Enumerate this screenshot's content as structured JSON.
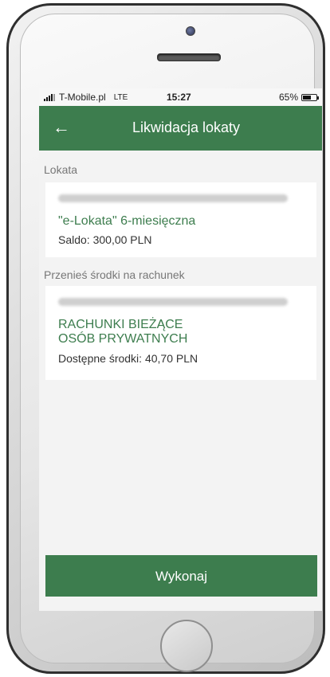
{
  "status_bar": {
    "carrier": "T-Mobile.pl",
    "network": "LTE",
    "time": "15:27",
    "battery": "65%",
    "battery_level": 0.65
  },
  "app_bar": {
    "back_icon": "arrow-left-icon",
    "title": "Likwidacja lokaty"
  },
  "deposit_section": {
    "label": "Lokata",
    "card": {
      "name": "\"e-Lokata\" 6-miesięczna",
      "balance": "Saldo: 300,00 PLN"
    }
  },
  "transfer_section": {
    "label": "Przenieś środki na rachunek",
    "card": {
      "name_line1": "RACHUNKI BIEŻĄCE",
      "name_line2": "OSÓB PRYWATNYCH",
      "available": "Dostępne środki: 40,70 PLN"
    }
  },
  "submit_button": "Wykonaj",
  "colors": {
    "brand_green": "#3d7d4e",
    "background": "#f3f3f3"
  }
}
